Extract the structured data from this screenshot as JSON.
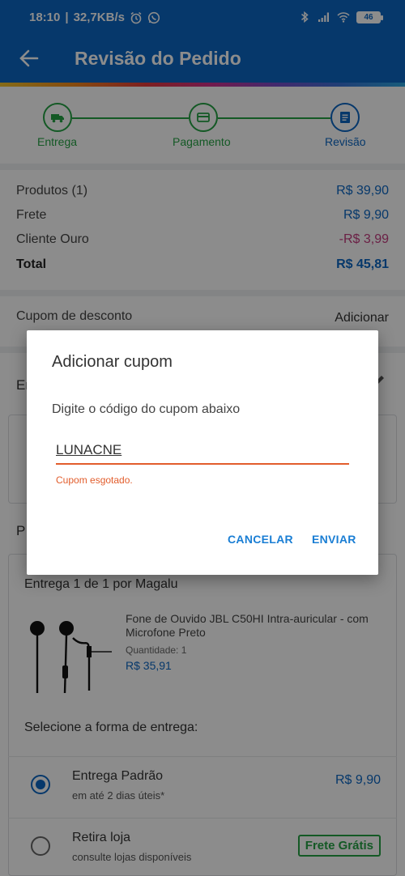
{
  "status_bar": {
    "time": "18:10",
    "speed": "32,7KB/s",
    "battery": "46"
  },
  "app_bar": {
    "title": "Revisão do Pedido"
  },
  "stepper": {
    "steps": [
      {
        "label": "Entrega"
      },
      {
        "label": "Pagamento"
      },
      {
        "label": "Revisão"
      }
    ]
  },
  "summary": {
    "rows": [
      {
        "label": "Produtos (1)",
        "value": "R$ 39,90"
      },
      {
        "label": "Frete",
        "value": "R$ 9,90"
      },
      {
        "label": "Cliente Ouro",
        "value": "-R$ 3,99"
      },
      {
        "label": "Total",
        "value": "R$ 45,81"
      }
    ]
  },
  "coupon": {
    "label": "Cupom de desconto",
    "action": "Adicionar"
  },
  "delivery_section": {
    "title_partial": "En"
  },
  "products_section": {
    "title_partial": "P",
    "seller": "Entrega 1 de 1 por Magalu",
    "product": {
      "name": "Fone de Ouvido JBL C50HI Intra-auricular - com Microfone Preto",
      "quantity_label": "Quantidade:",
      "quantity": "1",
      "price": "R$ 35,91"
    },
    "shipping_title": "Selecione a forma de entrega:",
    "options": [
      {
        "title": "Entrega Padrão",
        "subtitle": "em até 2 dias úteis*",
        "price": "R$ 9,90",
        "selected": true
      },
      {
        "title": "Retira loja",
        "subtitle": "consulte lojas disponíveis",
        "badge": "Frete Grátis",
        "selected": false
      }
    ]
  },
  "dialog": {
    "title": "Adicionar cupom",
    "message": "Digite o código do cupom abaixo",
    "input_value": "LUNACNE",
    "error": "Cupom esgotado.",
    "cancel": "CANCELAR",
    "submit": "ENVIAR"
  },
  "colors": {
    "primary": "#0b66c3",
    "success": "#25a244",
    "error": "#e25d2c",
    "discount": "#c33b7f"
  }
}
